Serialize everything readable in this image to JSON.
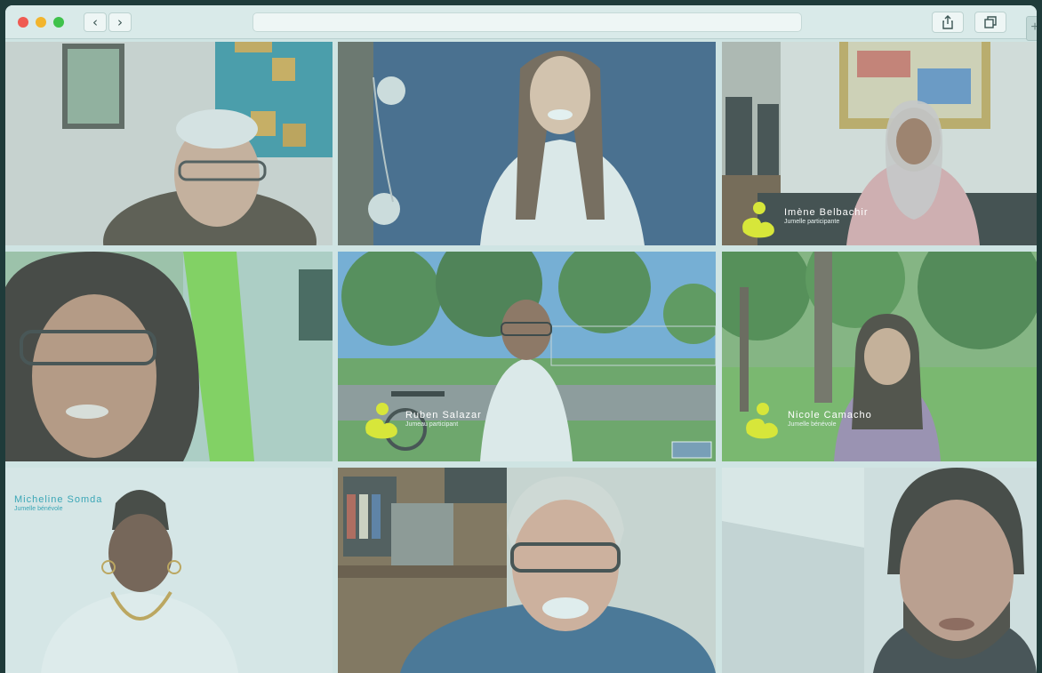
{
  "window": {
    "back_glyph": "‹",
    "forward_glyph": "›",
    "new_tab_glyph": "+",
    "icons": [
      "share-icon",
      "tabs-icon"
    ]
  },
  "colors": {
    "accent_logo": "#d7e63a",
    "caption_blue": "#3aa6b6"
  },
  "participants": [
    {
      "name": "",
      "role": ""
    },
    {
      "name": "",
      "role": ""
    },
    {
      "name": "Imène Belbachir",
      "role": "Jumelle participante"
    },
    {
      "name": "",
      "role": ""
    },
    {
      "name": "Ruben Salazar",
      "role": "Jumeau participant"
    },
    {
      "name": "Nicole Camacho",
      "role": "Jumelle bénévole"
    },
    {
      "name": "Micheline Somda",
      "role": "Jumelle bénévole"
    },
    {
      "name": "",
      "role": ""
    },
    {
      "name": "",
      "role": ""
    }
  ]
}
